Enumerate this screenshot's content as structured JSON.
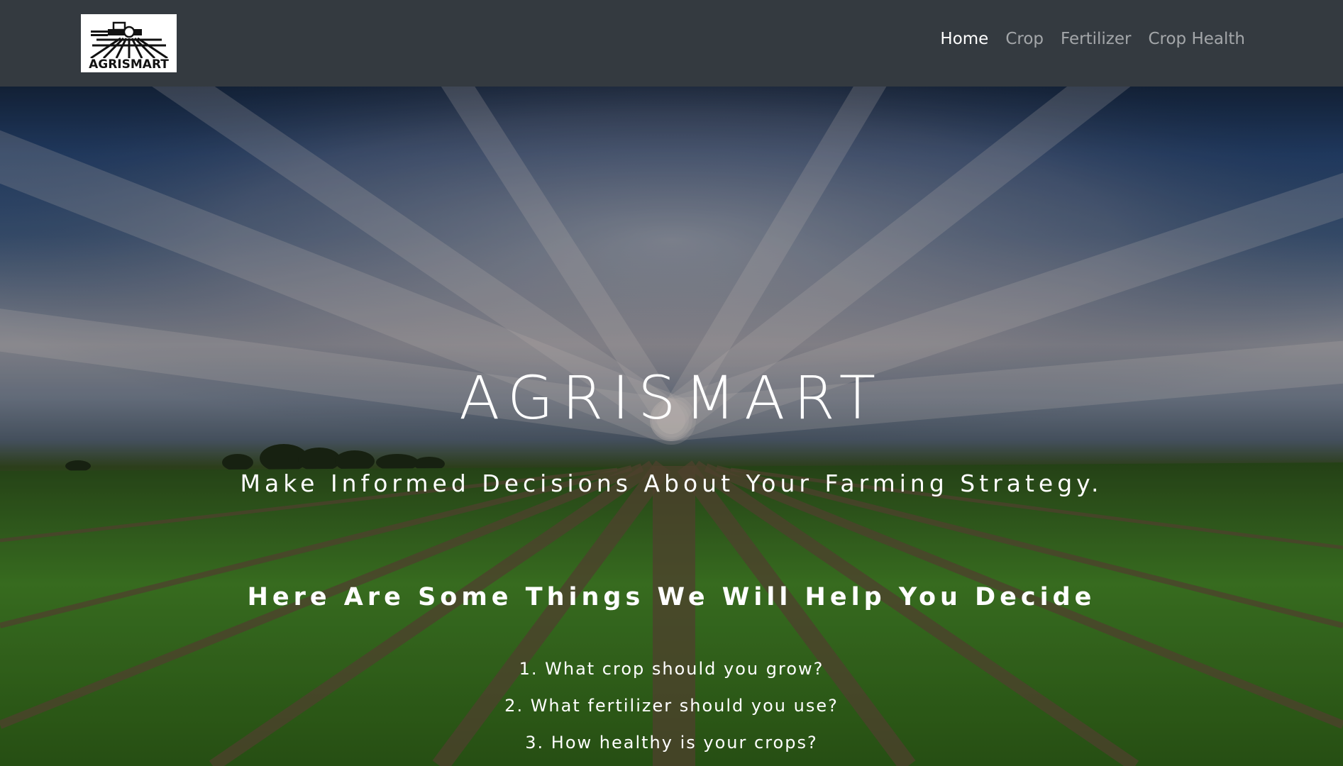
{
  "brand": {
    "logo_text": "AGRISMART",
    "logo_icon": "tractor-field-icon"
  },
  "nav": {
    "items": [
      {
        "label": "Home",
        "active": true
      },
      {
        "label": "Crop",
        "active": false
      },
      {
        "label": "Fertilizer",
        "active": false
      },
      {
        "label": "Crop Health",
        "active": false
      }
    ]
  },
  "hero": {
    "title": "AGRISMART",
    "tagline": "Make Informed Decisions About Your Farming Strategy.",
    "subtitle": "Here Are Some Things We Will Help You Decide",
    "questions": [
      "1. What crop should you grow?",
      "2. What fertilizer should you use?",
      "3. How healthy is your crops?"
    ]
  },
  "colors": {
    "navbar_bg": "#343a40",
    "nav_active": "#ffffff",
    "nav_inactive": "rgba(255,255,255,0.55)"
  }
}
